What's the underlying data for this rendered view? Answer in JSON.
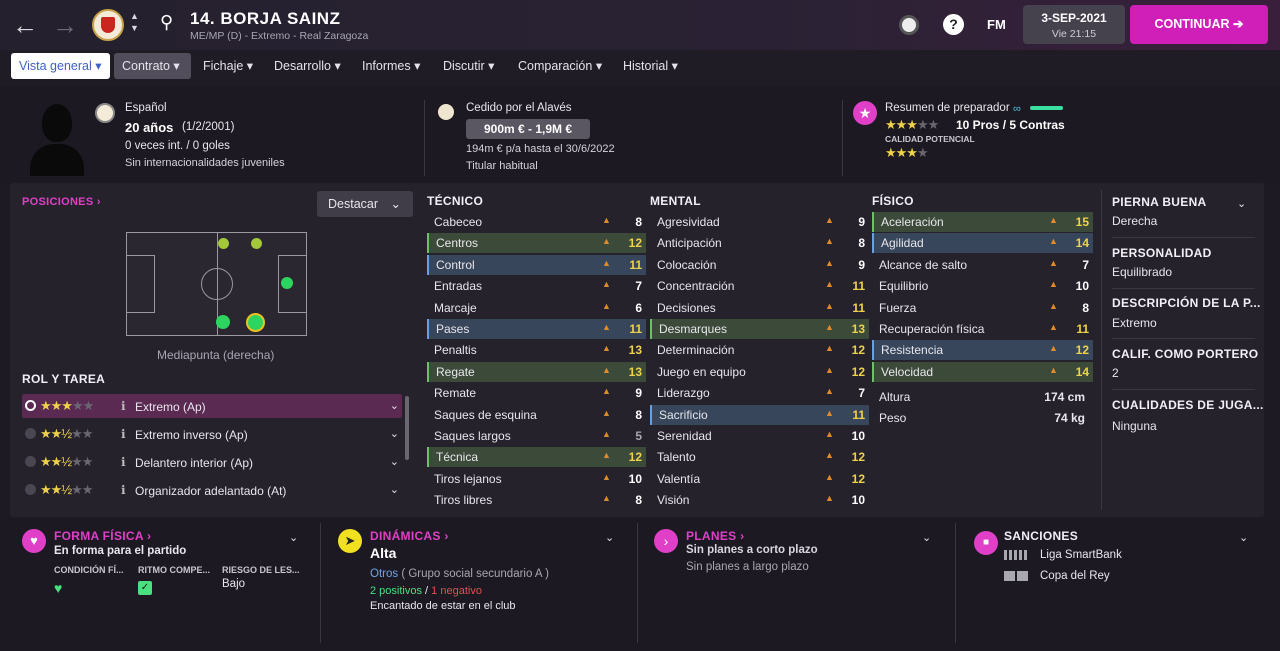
{
  "topbar": {
    "player_title": "14. BORJA SAINZ",
    "subtitle": "ME/MP (D) - Extremo - Real Zaragoza",
    "fm_label": "FM",
    "date": "3-SEP-2021",
    "time": "Vie 21:15",
    "continue_label": "CONTINUAR"
  },
  "tabs": [
    {
      "label": "Vista general"
    },
    {
      "label": "Contrato"
    },
    {
      "label": "Fichaje"
    },
    {
      "label": "Desarrollo"
    },
    {
      "label": "Informes"
    },
    {
      "label": "Discutir"
    },
    {
      "label": "Comparación"
    },
    {
      "label": "Historial"
    }
  ],
  "header": {
    "nationality": "Español",
    "age": "20 años",
    "dob": "(1/2/2001)",
    "caps": "0 veces int. / 0 goles",
    "youth_caps": "Sin internacionalidades juveniles",
    "loan": "Cedido por el Alavés",
    "value": "900m € - 1,9M €",
    "wage": "194m € p/a hasta el 30/6/2022",
    "status": "Titular habitual",
    "coach_summary": "Resumen de preparador",
    "pros_cons": "10 Pros / 5 Contras",
    "potential_label": "CALIDAD POTENCIAL",
    "current_stars": 3,
    "potential_stars": 3.5
  },
  "positions": {
    "title": "POSICIONES",
    "highlight_label": "Destacar",
    "pitch_caption": "Mediapunta (derecha)"
  },
  "roles": {
    "title": "ROL Y TAREA",
    "items": [
      {
        "label": "Extremo (Ap)",
        "stars": 3
      },
      {
        "label": "Extremo inverso (Ap)",
        "stars": 2.5
      },
      {
        "label": "Delantero interior (Ap)",
        "stars": 2.5
      },
      {
        "label": "Organizador adelantado (At)",
        "stars": 2.5
      }
    ]
  },
  "technical": {
    "title": "TÉCNICO",
    "rows": [
      {
        "name": "Cabeceo",
        "value": "8"
      },
      {
        "name": "Centros",
        "value": "12"
      },
      {
        "name": "Control",
        "value": "11"
      },
      {
        "name": "Entradas",
        "value": "7"
      },
      {
        "name": "Marcaje",
        "value": "6"
      },
      {
        "name": "Pases",
        "value": "11"
      },
      {
        "name": "Penaltis",
        "value": "13"
      },
      {
        "name": "Regate",
        "value": "13"
      },
      {
        "name": "Remate",
        "value": "9"
      },
      {
        "name": "Saques de esquina",
        "value": "8"
      },
      {
        "name": "Saques largos",
        "value": "5"
      },
      {
        "name": "Técnica",
        "value": "12"
      },
      {
        "name": "Tiros lejanos",
        "value": "10"
      },
      {
        "name": "Tiros libres",
        "value": "8"
      }
    ]
  },
  "mental": {
    "title": "MENTAL",
    "rows": [
      {
        "name": "Agresividad",
        "value": "9"
      },
      {
        "name": "Anticipación",
        "value": "8"
      },
      {
        "name": "Colocación",
        "value": "9"
      },
      {
        "name": "Concentración",
        "value": "11"
      },
      {
        "name": "Decisiones",
        "value": "11"
      },
      {
        "name": "Desmarques",
        "value": "13"
      },
      {
        "name": "Determinación",
        "value": "12"
      },
      {
        "name": "Juego en equipo",
        "value": "12"
      },
      {
        "name": "Liderazgo",
        "value": "7"
      },
      {
        "name": "Sacrificio",
        "value": "11"
      },
      {
        "name": "Serenidad",
        "value": "10"
      },
      {
        "name": "Talento",
        "value": "12"
      },
      {
        "name": "Valentía",
        "value": "12"
      },
      {
        "name": "Visión",
        "value": "10"
      }
    ]
  },
  "physical": {
    "title": "FÍSICO",
    "rows": [
      {
        "name": "Aceleración",
        "value": "15"
      },
      {
        "name": "Agilidad",
        "value": "14"
      },
      {
        "name": "Alcance de salto",
        "value": "7"
      },
      {
        "name": "Equilibrio",
        "value": "10"
      },
      {
        "name": "Fuerza",
        "value": "8"
      },
      {
        "name": "Recuperación física",
        "value": "11"
      },
      {
        "name": "Resistencia",
        "value": "12"
      },
      {
        "name": "Velocidad",
        "value": "14"
      }
    ],
    "height_label": "Altura",
    "height": "174 cm",
    "weight_label": "Peso",
    "weight": "74 kg"
  },
  "sidebar": [
    {
      "title": "PIERNA BUENA",
      "value": "Derecha"
    },
    {
      "title": "PERSONALIDAD",
      "value": "Equilibrado"
    },
    {
      "title": "DESCRIPCIÓN DE LA P...",
      "value": "Extremo"
    },
    {
      "title": "CALIF. COMO PORTERO",
      "value": "2"
    },
    {
      "title": "CUALIDADES DE JUGA...",
      "value": "Ninguna"
    }
  ],
  "fitness": {
    "title": "FORMA FÍSICA",
    "status": "En forma para el partido",
    "col1": "CONDICIÓN FÍ...",
    "col2": "RITMO COMPE...",
    "col3": "RIESGO DE LES...",
    "risk": "Bajo"
  },
  "dynamics": {
    "title": "DINÁMICAS",
    "level": "Alta",
    "group": "Otros",
    "group_desc": "( Grupo social secundario A )",
    "positive": "2 positivos",
    "slash": "/",
    "negative": "1 negativo",
    "note": "Encantado de estar en el club"
  },
  "plans": {
    "title": "PLANES",
    "short": "Sin planes a corto plazo",
    "long": "Sin planes a largo plazo"
  },
  "sanctions": {
    "title": "SANCIONES",
    "items": [
      {
        "label": "Liga SmartBank"
      },
      {
        "label": "Copa del Rey"
      }
    ]
  },
  "colors": {
    "accent": "#e040c8",
    "highlight": "#f0d24a",
    "good": "#6dbf6a"
  }
}
